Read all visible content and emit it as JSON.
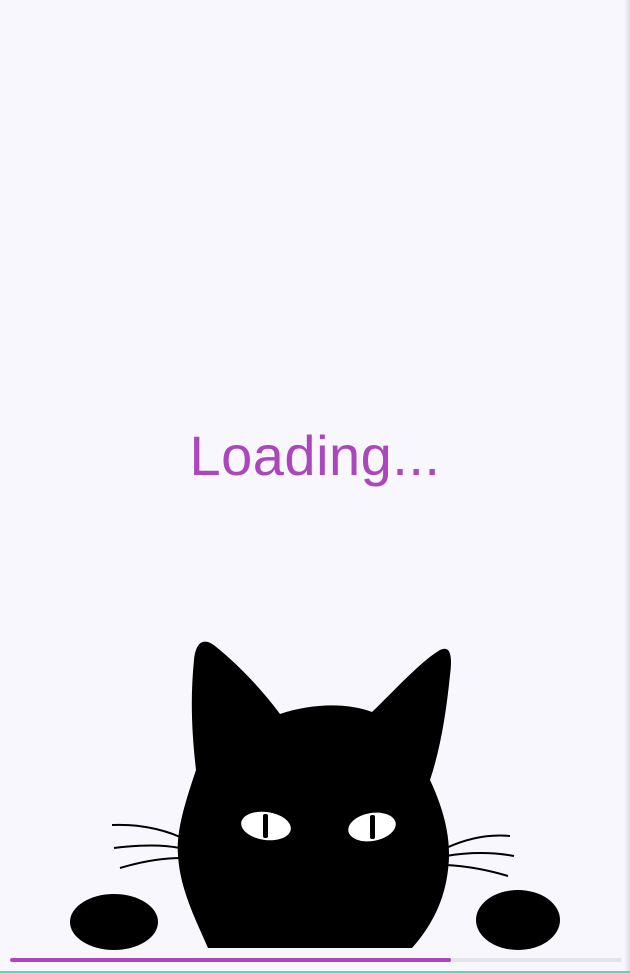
{
  "loading": {
    "text": "Loading..."
  },
  "progress": {
    "value": 0.72
  },
  "illustration": {
    "icon": "peeking-black-cat-icon"
  },
  "colors": {
    "background": "#f7f7fd",
    "accent": "#ab47bc",
    "track": "#e4e3ea",
    "cat": "#000000"
  }
}
